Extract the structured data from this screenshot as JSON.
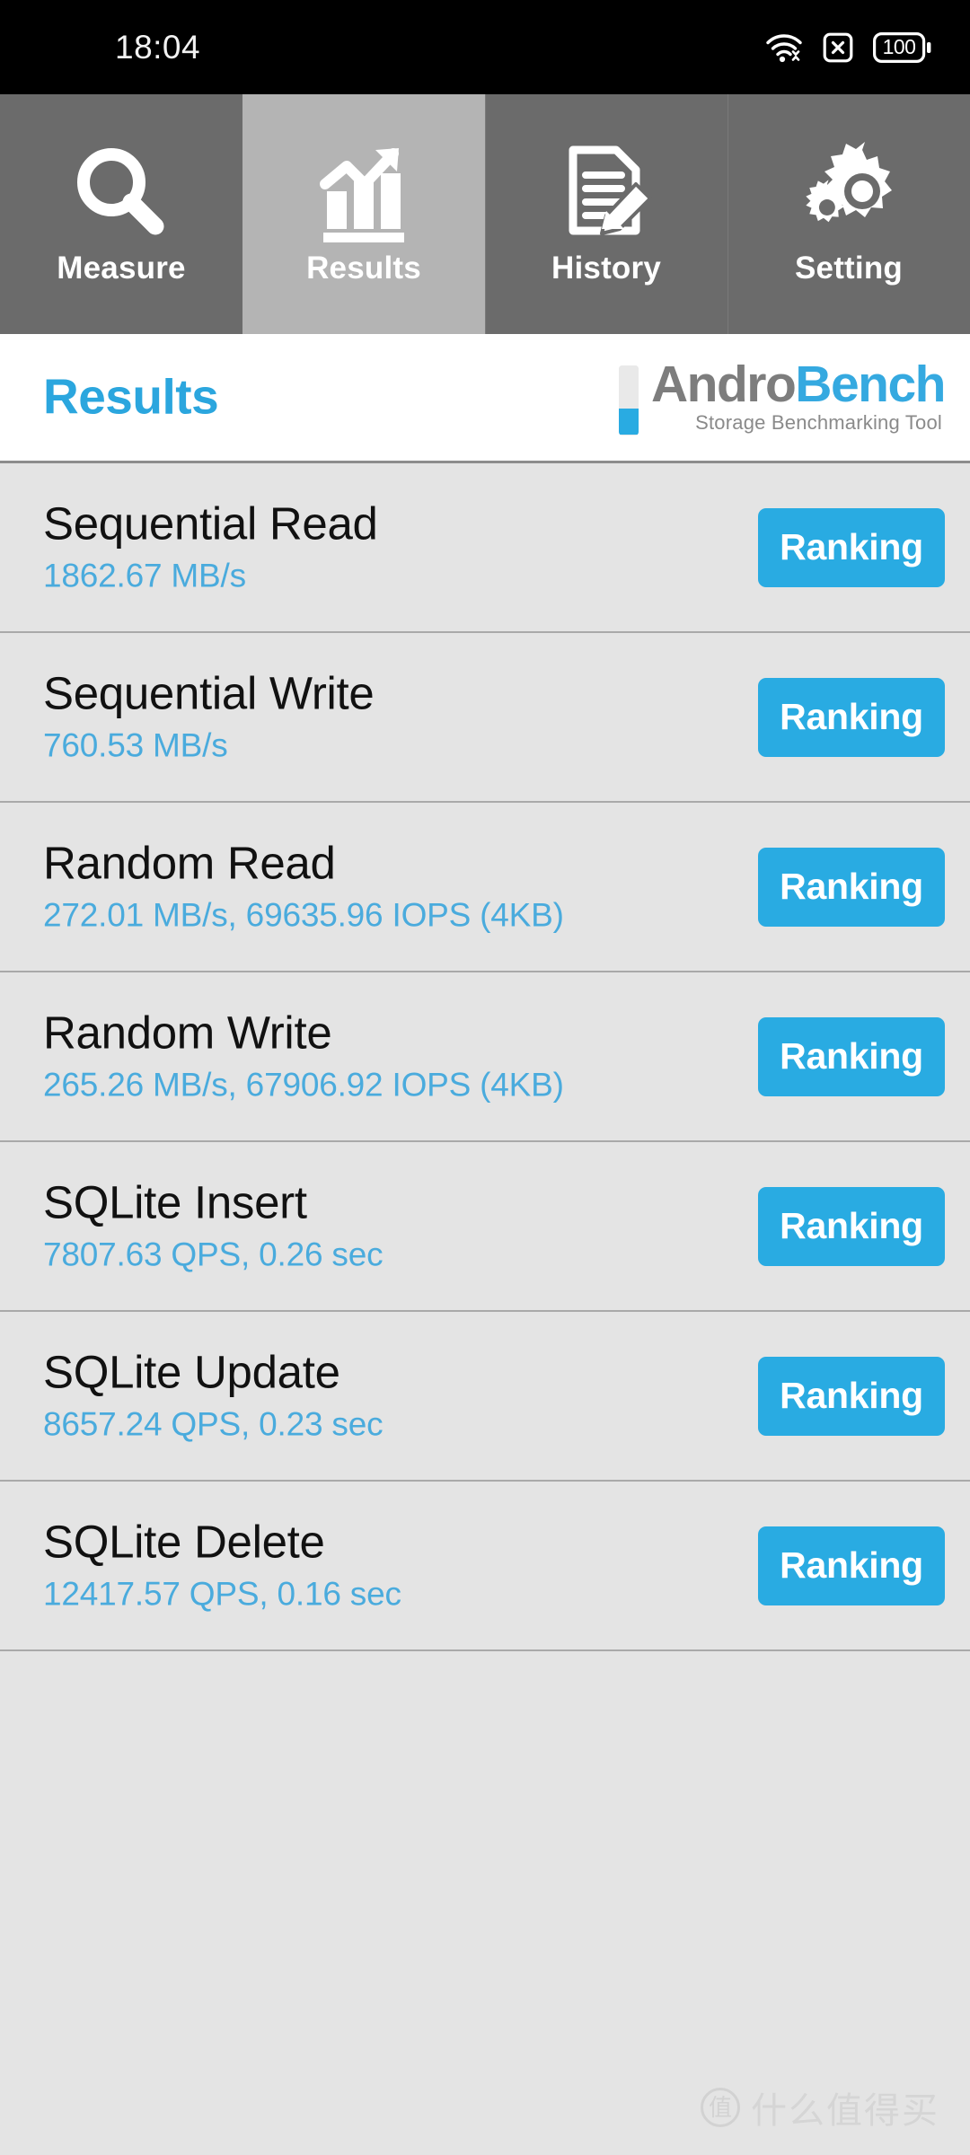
{
  "status_bar": {
    "time": "18:04",
    "battery_level": "100",
    "icons": [
      "wifi-icon",
      "no-sim-icon",
      "battery-icon"
    ]
  },
  "tabs": [
    {
      "label": "Measure",
      "icon": "magnifier-icon",
      "active": false
    },
    {
      "label": "Results",
      "icon": "bar-chart-arrow-icon",
      "active": true
    },
    {
      "label": "History",
      "icon": "document-pencil-icon",
      "active": false
    },
    {
      "label": "Setting",
      "icon": "gears-icon",
      "active": false
    }
  ],
  "header": {
    "title": "Results",
    "logo": {
      "part1": "Andro",
      "part2": "Bench",
      "tagline": "Storage Benchmarking Tool"
    }
  },
  "results": [
    {
      "name": "Sequential Read",
      "value": "1862.67 MB/s",
      "button": "Ranking"
    },
    {
      "name": "Sequential Write",
      "value": "760.53 MB/s",
      "button": "Ranking"
    },
    {
      "name": "Random Read",
      "value": "272.01 MB/s, 69635.96 IOPS (4KB)",
      "button": "Ranking"
    },
    {
      "name": "Random Write",
      "value": "265.26 MB/s, 67906.92 IOPS (4KB)",
      "button": "Ranking"
    },
    {
      "name": "SQLite Insert",
      "value": "7807.63 QPS, 0.26 sec",
      "button": "Ranking"
    },
    {
      "name": "SQLite Update",
      "value": "8657.24 QPS, 0.23 sec",
      "button": "Ranking"
    },
    {
      "name": "SQLite Delete",
      "value": "12417.57 QPS, 0.16 sec",
      "button": "Ranking"
    }
  ],
  "watermark": {
    "mark": "值",
    "text": "什么值得买"
  },
  "colors": {
    "accent_blue": "#29abe2",
    "value_blue": "#4aabdd",
    "tab_inactive": "#6b6b6b",
    "tab_active": "#b4b4b4",
    "list_bg": "#e4e4e4",
    "header_bg": "#ffffff",
    "status_bg": "#000000"
  }
}
